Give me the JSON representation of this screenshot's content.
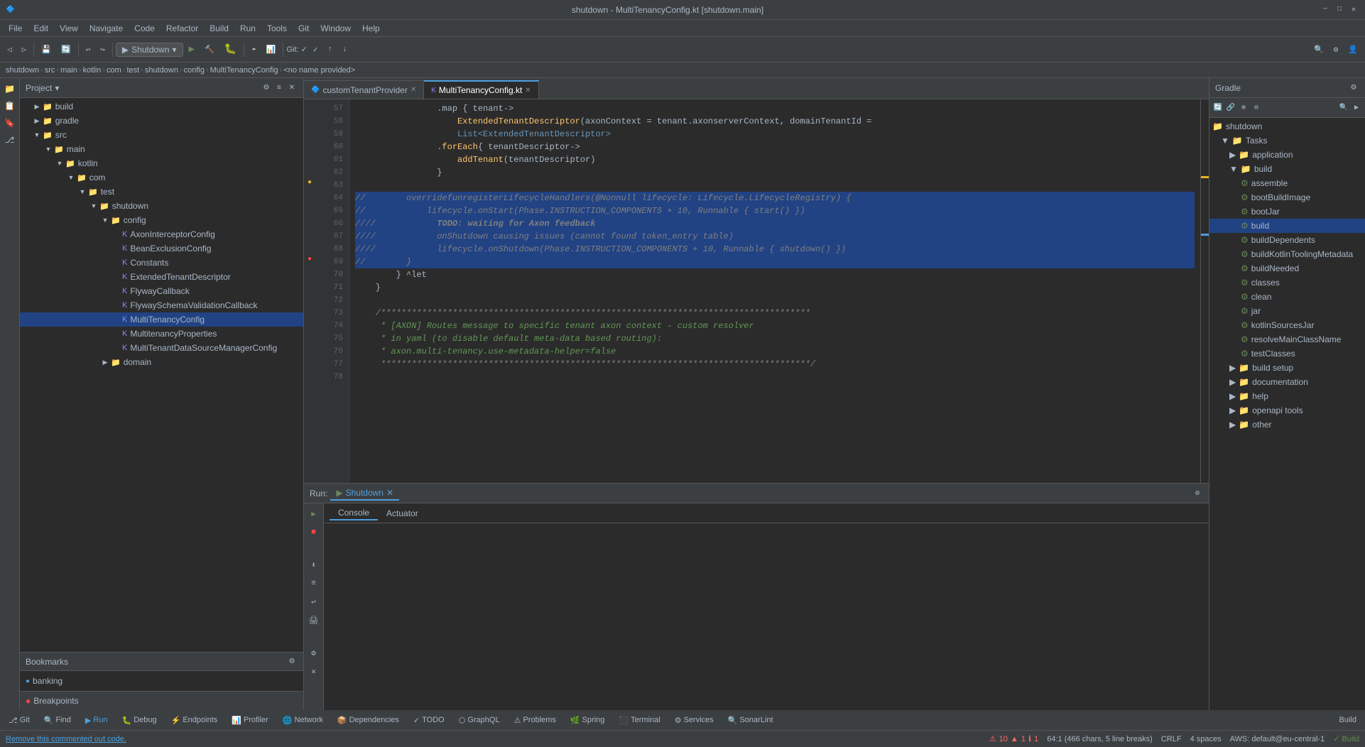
{
  "titleBar": {
    "title": "shutdown - MultiTenancyConfig.kt [shutdown.main]",
    "closeBtn": "✕",
    "minBtn": "─",
    "maxBtn": "□"
  },
  "menuBar": {
    "items": [
      "File",
      "Edit",
      "View",
      "Navigate",
      "Code",
      "Refactor",
      "Build",
      "Run",
      "Tools",
      "Git",
      "Window",
      "Help"
    ]
  },
  "toolbar": {
    "runConfig": "Shutdown",
    "gitLabel": "Git:",
    "runBtn": "▶",
    "debugBtn": "🐛"
  },
  "breadcrumb": {
    "items": [
      "shutdown",
      "src",
      "main",
      "kotlin",
      "com",
      "test",
      "shutdown",
      "config",
      "MultiTenancyConfig",
      "<no name provided>"
    ]
  },
  "tabs": [
    {
      "label": "MultiTenancyConfig.kt",
      "active": true,
      "icon": "K"
    },
    {
      "label": "customTenantProvider",
      "active": false,
      "icon": "🔷"
    }
  ],
  "projectPanel": {
    "title": "Project",
    "items": [
      {
        "indent": 0,
        "label": "build",
        "type": "folder",
        "expanded": true
      },
      {
        "indent": 1,
        "label": "gradle",
        "type": "folder",
        "expanded": false
      },
      {
        "indent": 1,
        "label": "src",
        "type": "folder",
        "expanded": true
      },
      {
        "indent": 2,
        "label": "main",
        "type": "folder",
        "expanded": true
      },
      {
        "indent": 3,
        "label": "kotlin",
        "type": "folder",
        "expanded": true
      },
      {
        "indent": 4,
        "label": "com",
        "type": "folder",
        "expanded": true
      },
      {
        "indent": 5,
        "label": "test",
        "type": "folder",
        "expanded": true
      },
      {
        "indent": 6,
        "label": "shutdown",
        "type": "folder",
        "expanded": true
      },
      {
        "indent": 7,
        "label": "config",
        "type": "folder",
        "expanded": true
      },
      {
        "indent": 8,
        "label": "AxonInterceptorConfig",
        "type": "kt"
      },
      {
        "indent": 8,
        "label": "BeanExclusionConfig",
        "type": "kt"
      },
      {
        "indent": 8,
        "label": "Constants",
        "type": "kt"
      },
      {
        "indent": 8,
        "label": "ExtendedTenantDescriptor",
        "type": "kt"
      },
      {
        "indent": 8,
        "label": "FlywayCallback",
        "type": "kt"
      },
      {
        "indent": 8,
        "label": "FlywaySchemaValidationCallback",
        "type": "kt"
      },
      {
        "indent": 8,
        "label": "MultiTenancyConfig",
        "type": "kt",
        "selected": true
      },
      {
        "indent": 8,
        "label": "MultitenancyProperties",
        "type": "kt"
      },
      {
        "indent": 8,
        "label": "MultiTenantDataSourceManagerConfig",
        "type": "kt"
      },
      {
        "indent": 7,
        "label": "domain",
        "type": "folder",
        "expanded": false
      }
    ]
  },
  "bookmarks": {
    "title": "Bookmarks",
    "items": [
      {
        "label": "banking",
        "icon": "●",
        "color": "#4e9fde"
      },
      {
        "label": "Breakpoints",
        "icon": "○"
      }
    ]
  },
  "codeLines": [
    {
      "num": 57,
      "tokens": [
        {
          "t": "                .map { tenant->",
          "c": "plain"
        }
      ],
      "mark": ""
    },
    {
      "num": 58,
      "tokens": [
        {
          "t": "                    ExtendedTenantDescriptor(axonContext = tenant.axonserverContext, domainTenantId =",
          "c": "plain"
        }
      ],
      "mark": ""
    },
    {
      "num": 59,
      "tokens": [
        {
          "t": "                    List<ExtendedTenantDescriptor>",
          "c": "plain"
        }
      ],
      "mark": ""
    },
    {
      "num": 60,
      "tokens": [
        {
          "t": "                .forEach { tenantDescriptor->",
          "c": "plain"
        }
      ],
      "mark": ""
    },
    {
      "num": 61,
      "tokens": [
        {
          "t": "                    addTenant(tenantDescriptor)",
          "c": "plain"
        }
      ],
      "mark": ""
    },
    {
      "num": 62,
      "tokens": [
        {
          "t": "                }",
          "c": "plain"
        }
      ],
      "mark": ""
    },
    {
      "num": 63,
      "tokens": [
        {
          "t": "",
          "c": "plain"
        }
      ],
      "mark": "warning"
    },
    {
      "num": 64,
      "tokens": [
        {
          "t": "//        override fun registerLifecycleHandlers(@Nonnull lifecycle: Lifecycle.LifecycleRegistry) {",
          "c": "cm"
        }
      ],
      "mark": "",
      "highlighted": true
    },
    {
      "num": 65,
      "tokens": [
        {
          "t": "//            lifecycle.onStart(Phase.INSTRUCTION_COMPONENTS + 10, Runnable { start() })",
          "c": "cm"
        }
      ],
      "mark": "",
      "highlighted": true
    },
    {
      "num": 66,
      "tokens": [
        {
          "t": "////            TODO: waiting for Axon feedback",
          "c": "cm"
        }
      ],
      "mark": "",
      "highlighted": true
    },
    {
      "num": 67,
      "tokens": [
        {
          "t": "////            onShutdown causing issues (cannot found token_entry table)",
          "c": "cm"
        }
      ],
      "mark": "",
      "highlighted": true
    },
    {
      "num": 68,
      "tokens": [
        {
          "t": "////            lifecycle.onShutdown(Phase.INSTRUCTION_COMPONENTS + 10, Runnable { shutdown() })",
          "c": "cm"
        }
      ],
      "mark": "",
      "highlighted": true
    },
    {
      "num": 69,
      "tokens": [
        {
          "t": "//        }",
          "c": "cm"
        }
      ],
      "mark": "breakpoint",
      "highlighted": true
    },
    {
      "num": 70,
      "tokens": [
        {
          "t": "        } ^let",
          "c": "plain"
        }
      ],
      "mark": ""
    },
    {
      "num": 71,
      "tokens": [
        {
          "t": "    }",
          "c": "plain"
        }
      ],
      "mark": ""
    },
    {
      "num": 72,
      "tokens": [
        {
          "t": "",
          "c": "plain"
        }
      ],
      "mark": ""
    },
    {
      "num": 73,
      "tokens": [
        {
          "t": "    /**********************************************************************************",
          "c": "cm"
        }
      ],
      "mark": ""
    },
    {
      "num": 74,
      "tokens": [
        {
          "t": "     * [AXON] Routes message to specific tenant axon context - custom resolver",
          "c": "cm-special"
        }
      ],
      "mark": ""
    },
    {
      "num": 75,
      "tokens": [
        {
          "t": "     * in yaml (to disable default meta-data based routing):",
          "c": "cm-special"
        }
      ],
      "mark": ""
    },
    {
      "num": 76,
      "tokens": [
        {
          "t": "     * axon.multi-tenancy.use-metadata-helper=false",
          "c": "cm-special"
        }
      ],
      "mark": ""
    },
    {
      "num": 77,
      "tokens": [
        {
          "t": "     ***********************************************************************************/",
          "c": "cm"
        }
      ],
      "mark": ""
    },
    {
      "num": 78,
      "tokens": [
        {
          "t": "",
          "c": "plain"
        }
      ],
      "mark": ""
    }
  ],
  "gradlePanel": {
    "title": "Gradle",
    "items": [
      {
        "indent": 0,
        "label": "shutdown",
        "type": "folder",
        "expanded": true
      },
      {
        "indent": 1,
        "label": "Tasks",
        "type": "folder",
        "expanded": true
      },
      {
        "indent": 2,
        "label": "application",
        "type": "folder",
        "expanded": false
      },
      {
        "indent": 2,
        "label": "build",
        "type": "folder",
        "expanded": true
      },
      {
        "indent": 3,
        "label": "assemble",
        "type": "task"
      },
      {
        "indent": 3,
        "label": "bootBuildImage",
        "type": "task"
      },
      {
        "indent": 3,
        "label": "bootJar",
        "type": "task"
      },
      {
        "indent": 3,
        "label": "build",
        "type": "task",
        "selected": true
      },
      {
        "indent": 3,
        "label": "buildDependents",
        "type": "task"
      },
      {
        "indent": 3,
        "label": "buildKotlinToolingMetadata",
        "type": "task"
      },
      {
        "indent": 3,
        "label": "buildNeeded",
        "type": "task"
      },
      {
        "indent": 3,
        "label": "classes",
        "type": "task"
      },
      {
        "indent": 3,
        "label": "clean",
        "type": "task"
      },
      {
        "indent": 3,
        "label": "jar",
        "type": "task"
      },
      {
        "indent": 3,
        "label": "kotlinSourcesJar",
        "type": "task"
      },
      {
        "indent": 3,
        "label": "resolveMainClassName",
        "type": "task"
      },
      {
        "indent": 3,
        "label": "testClasses",
        "type": "task"
      },
      {
        "indent": 2,
        "label": "build setup",
        "type": "folder",
        "expanded": false
      },
      {
        "indent": 2,
        "label": "documentation",
        "type": "folder",
        "expanded": false
      },
      {
        "indent": 2,
        "label": "help",
        "type": "folder",
        "expanded": false
      },
      {
        "indent": 2,
        "label": "openapi tools",
        "type": "folder",
        "expanded": false
      },
      {
        "indent": 2,
        "label": "other",
        "type": "folder",
        "expanded": false
      }
    ]
  },
  "runPanel": {
    "runLabel": "Run:",
    "runConfig": "Shutdown",
    "closeBtnLabel": "✕",
    "tabs": [
      {
        "label": "Console",
        "active": true
      },
      {
        "label": "Actuator",
        "active": false
      }
    ]
  },
  "bottomToolbar": {
    "items": [
      {
        "icon": "⎇",
        "label": "Git"
      },
      {
        "icon": "🔍",
        "label": "Find"
      },
      {
        "icon": "▶",
        "label": "Run",
        "active": true
      },
      {
        "icon": "🐛",
        "label": "Debug"
      },
      {
        "icon": "⚡",
        "label": "Endpoints"
      },
      {
        "icon": "📊",
        "label": "Profiler"
      },
      {
        "icon": "🌐",
        "label": "Network"
      },
      {
        "icon": "📦",
        "label": "Dependencies"
      },
      {
        "icon": "✓",
        "label": "TODO"
      },
      {
        "icon": "⬡",
        "label": "GraphQL"
      },
      {
        "icon": "⚠",
        "label": "Problems"
      },
      {
        "icon": "🌿",
        "label": "Spring"
      },
      {
        "icon": "⬛",
        "label": "Terminal"
      },
      {
        "icon": "⚙",
        "label": "Services"
      },
      {
        "icon": "🔍",
        "label": "SonarLint"
      }
    ],
    "buildBtn": "Build"
  },
  "statusBar": {
    "notification": "Remove this commented out code.",
    "position": "64:1 (466 chars, 5 line breaks)",
    "encoding": "CRLF",
    "indent": "4 spaces",
    "context": "AWS: default@eu-central-1",
    "errors": "⚠ 10",
    "warnings": "▲ 1",
    "info": "ℹ 1"
  },
  "errorIndicator": {
    "errors": 10,
    "warnings": 1,
    "info": 1
  }
}
